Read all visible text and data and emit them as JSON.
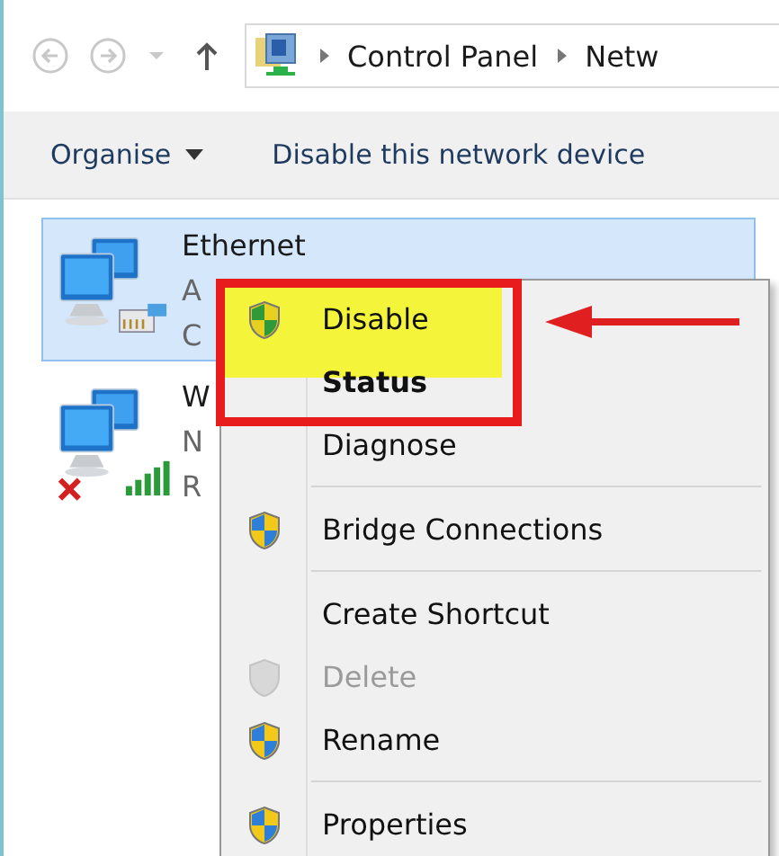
{
  "navigation": {
    "breadcrumbs": [
      "Control Panel",
      "Netw"
    ]
  },
  "toolbar": {
    "items": [
      {
        "label": "Organise",
        "kind": "dropdown"
      },
      {
        "label": "Disable this network device",
        "kind": "command"
      }
    ]
  },
  "connections": [
    {
      "name": "Ethernet",
      "lines": [
        "A",
        "C"
      ],
      "selected": true,
      "kind": "wired"
    },
    {
      "name": "W",
      "lines": [
        "N",
        "R"
      ],
      "selected": false,
      "kind": "wireless"
    }
  ],
  "menu": {
    "items": [
      {
        "kind": "item",
        "label": "Disable",
        "shield": true,
        "default": false,
        "disabled": false,
        "highlighted": true
      },
      {
        "kind": "item",
        "label": "Status",
        "shield": false,
        "default": true,
        "disabled": false,
        "highlighted": false
      },
      {
        "kind": "item",
        "label": "Diagnose",
        "shield": false,
        "default": false,
        "disabled": false,
        "highlighted": false
      },
      {
        "kind": "separator"
      },
      {
        "kind": "item",
        "label": "Bridge Connections",
        "shield": true,
        "default": false,
        "disabled": false,
        "highlighted": false
      },
      {
        "kind": "separator"
      },
      {
        "kind": "item",
        "label": "Create Shortcut",
        "shield": false,
        "default": false,
        "disabled": false,
        "highlighted": false
      },
      {
        "kind": "item",
        "label": "Delete",
        "shield": true,
        "default": false,
        "disabled": true,
        "highlighted": false
      },
      {
        "kind": "item",
        "label": "Rename",
        "shield": true,
        "default": false,
        "disabled": false,
        "highlighted": false
      },
      {
        "kind": "separator"
      },
      {
        "kind": "item",
        "label": "Properties",
        "shield": true,
        "default": false,
        "disabled": false,
        "highlighted": false
      }
    ]
  }
}
